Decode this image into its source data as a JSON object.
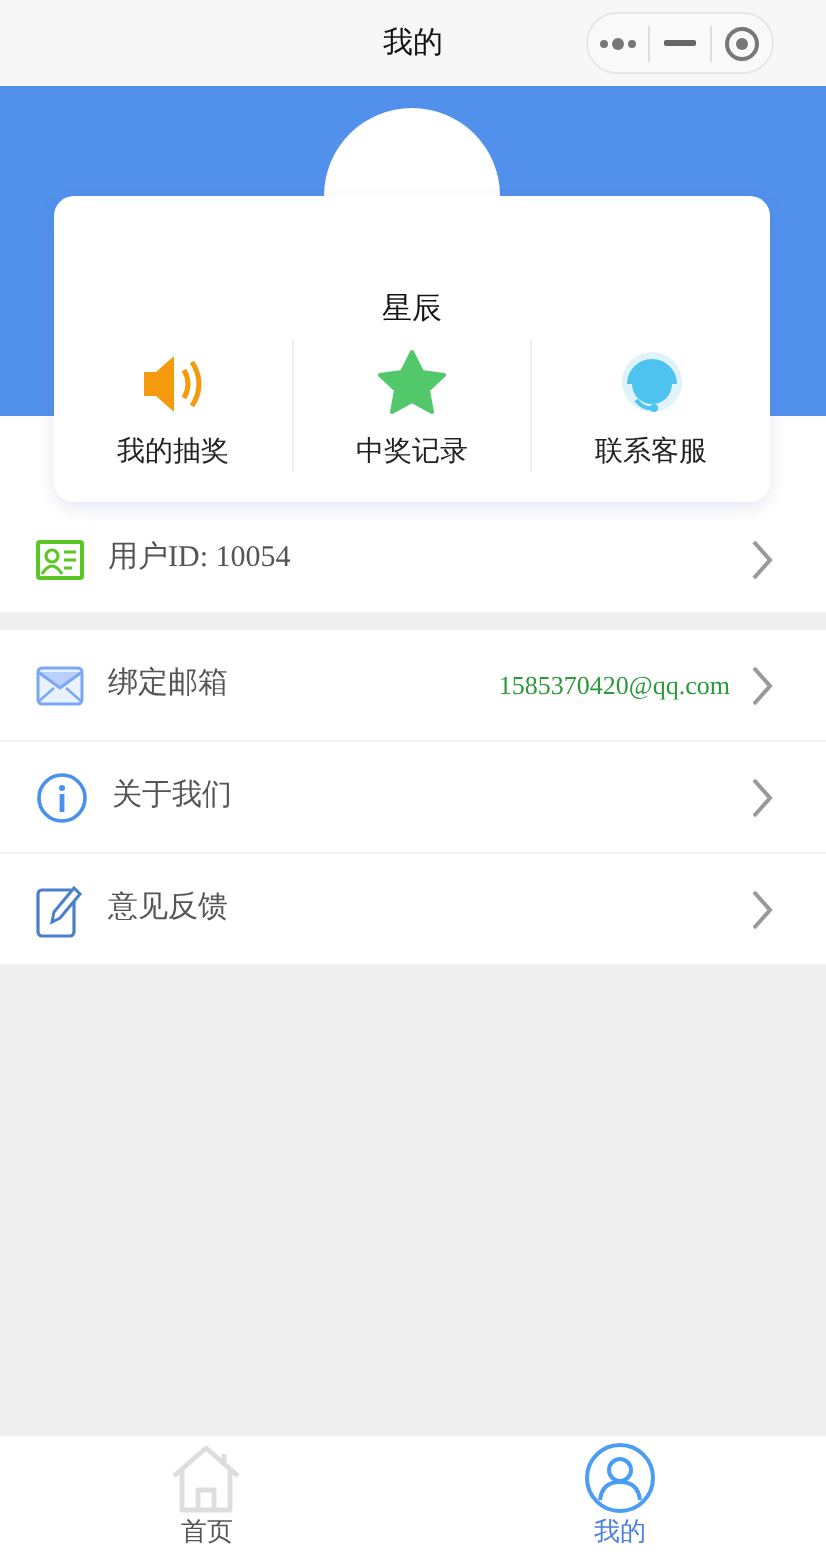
{
  "window": {
    "title": "我的"
  },
  "profile": {
    "name": "星辰"
  },
  "shortcuts": [
    {
      "kind": "speaker",
      "label": "我的抽奖"
    },
    {
      "kind": "star",
      "label": "中奖记录"
    },
    {
      "kind": "headset",
      "label": "联系客服"
    }
  ],
  "account": [
    {
      "kind": "id",
      "label": "用户ID: 10054"
    }
  ],
  "settings": [
    {
      "kind": "mail",
      "label": "绑定邮箱",
      "value": "1585370420@qq.com"
    },
    {
      "kind": "info",
      "label": "关于我们"
    },
    {
      "kind": "edit",
      "label": "意见反馈"
    }
  ],
  "tabs": [
    {
      "kind": "home",
      "label": "首页",
      "selected": false
    },
    {
      "kind": "user",
      "label": "我的",
      "selected": true
    }
  ]
}
